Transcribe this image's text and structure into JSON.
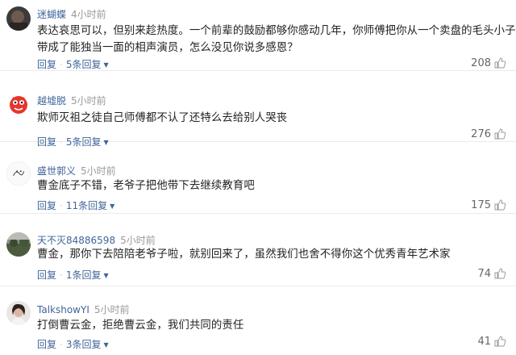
{
  "comments": [
    {
      "username": "迷蝴蝶",
      "time": "4小时前",
      "text_lines": [
        "表达哀思可以，但别来趁热度。一个前辈的鼓励都够你感动几年，你师傅把你从一个卖盘的毛头小子",
        "带成了能独当一面的相声演员，怎么没见你说多感恩？"
      ],
      "reply_label": "回复",
      "replies_label": "5条回复",
      "likes": "208",
      "avatar": "dark-photo-avatar"
    },
    {
      "username": "越墟脱",
      "time": "5小时前",
      "text_lines": [
        "欺师灭祖之徒自己师傅都不认了还特么去给别人哭丧"
      ],
      "reply_label": "回复",
      "replies_label": "5条回复",
      "likes": "276",
      "avatar": "red-cartoon-avatar"
    },
    {
      "username": "盛世郭义",
      "time": "5小时前",
      "text_lines": [
        "曹金底子不错，老爷子把他带下去继续教育吧"
      ],
      "reply_label": "回复",
      "replies_label": "11条回复",
      "likes": "175",
      "avatar": "white-doodle-avatar"
    },
    {
      "username": "天不灭84886598",
      "time": "5小时前",
      "text_lines": [
        "曹金，那你下去陪陪老爷子啦，就别回来了，虽然我们也舍不得你这个优秀青年艺术家"
      ],
      "reply_label": "回复",
      "replies_label": "1条回复",
      "likes": "74",
      "avatar": "landscape-photo-avatar"
    },
    {
      "username": "TalkshowYI",
      "time": "5小时前",
      "text_lines": [
        "打倒曹云金，拒绝曹云金，我们共同的责任"
      ],
      "reply_label": "回复",
      "replies_label": "3条回复",
      "likes": "41",
      "avatar": "portrait-photo-avatar"
    }
  ],
  "colors": {
    "username": "#406599",
    "time": "#999999",
    "text": "#222222",
    "likes": "#666666",
    "divider": "#ebebeb"
  }
}
